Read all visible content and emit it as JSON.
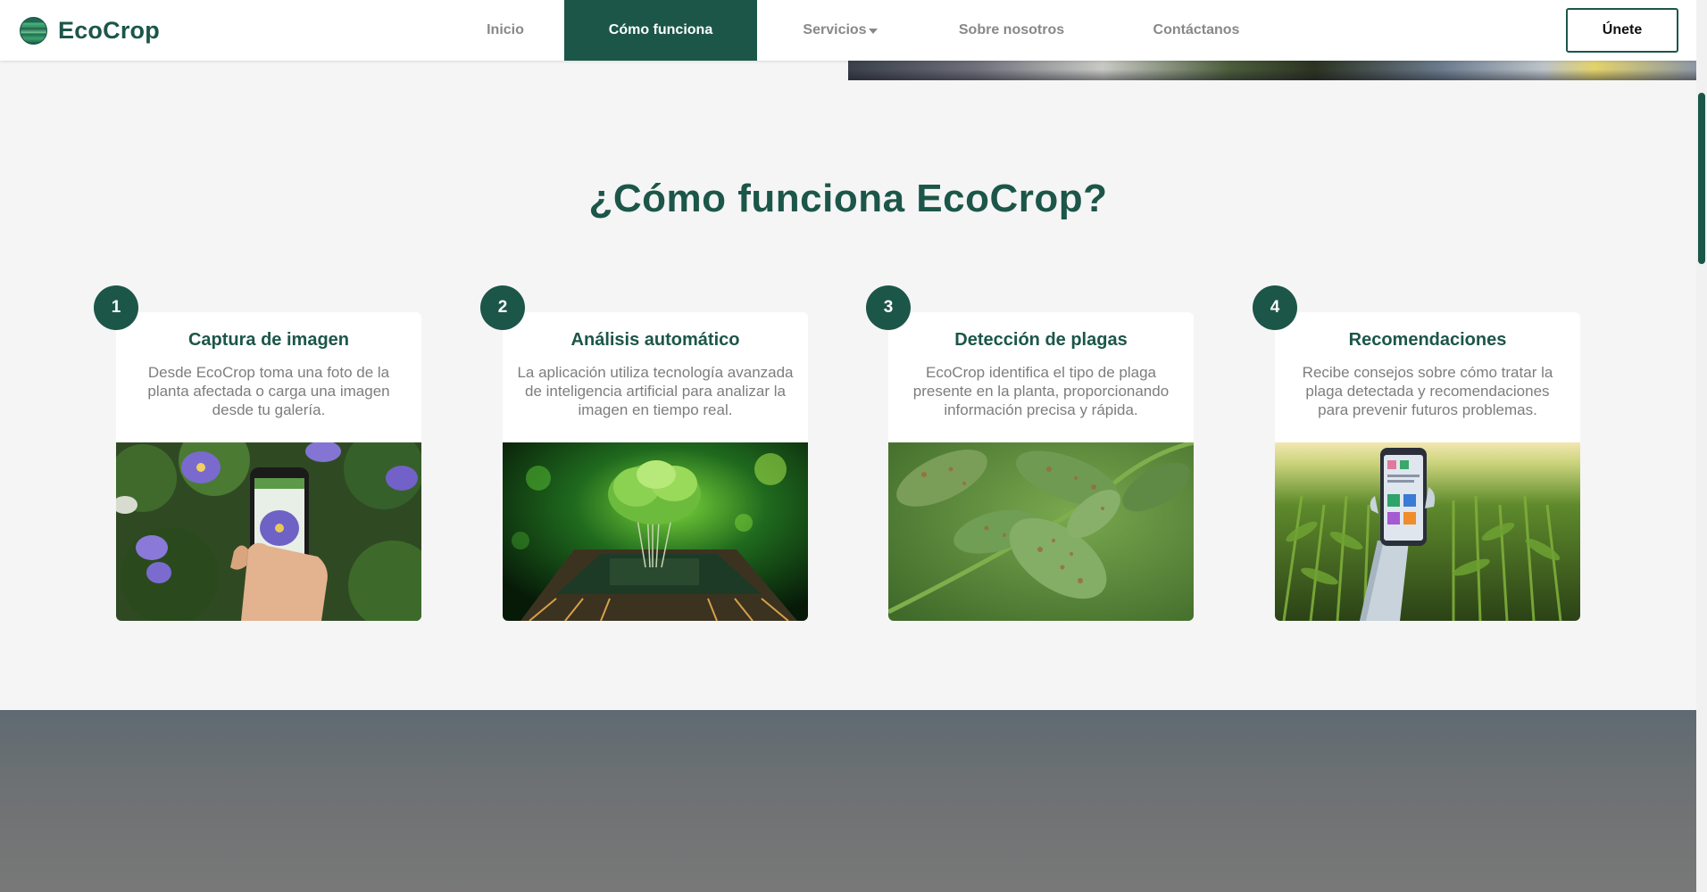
{
  "header": {
    "brand": "EcoCrop",
    "nav": [
      {
        "label": "Inicio"
      },
      {
        "label": "Cómo funciona",
        "active": true
      },
      {
        "label": "Servicios"
      },
      {
        "label": "Sobre nosotros"
      },
      {
        "label": "Contáctanos"
      }
    ],
    "join_label": "Únete"
  },
  "how_it_works": {
    "title": "¿Cómo funciona EcoCrop?",
    "steps": [
      {
        "number": "1",
        "title": "Captura de imagen",
        "description": "Desde EcoCrop toma una foto de la planta afectada o carga una imagen desde tu galería.",
        "image": "phone-photographing-flower"
      },
      {
        "number": "2",
        "title": "Análisis automático",
        "description": "La aplicación utiliza tecnología avanzada de inteligencia artificial para analizar la imagen en tiempo real.",
        "image": "tree-on-microchip"
      },
      {
        "number": "3",
        "title": "Detección de plagas",
        "description": "EcoCrop identifica el tipo de plaga presente en la planta, proporcionando información precisa y rápida.",
        "image": "leaves-with-pest-spots"
      },
      {
        "number": "4",
        "title": "Recomendaciones",
        "description": "Recibe consejos sobre cómo tratar la plaga detectada y recomendaciones para prevenir futuros problemas.",
        "image": "robot-hand-phone-cornfield"
      }
    ]
  },
  "colors": {
    "primary": "#1c5649",
    "background": "#f5f5f5",
    "muted_text": "#7d7d7d",
    "nav_text": "#888888"
  }
}
